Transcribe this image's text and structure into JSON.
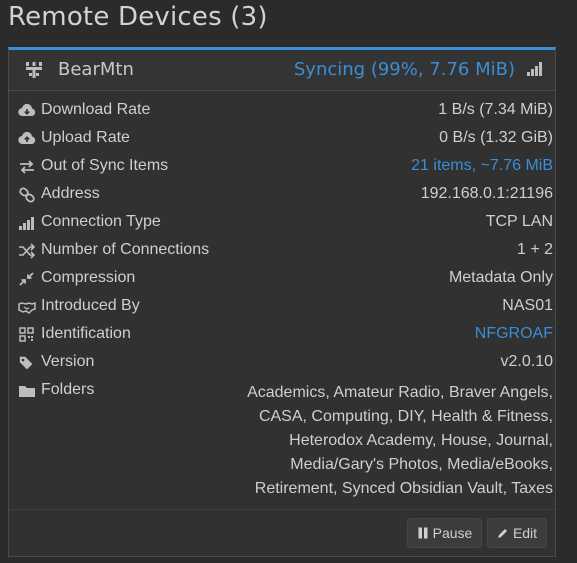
{
  "page": {
    "title": "Remote Devices (3)"
  },
  "device": {
    "name": "BearMtn",
    "status": "Syncing (99%, 7.76 MiB)",
    "rows": [
      {
        "key": "download_rate",
        "label": "Download Rate",
        "value": "1 B/s (7.34 MiB)",
        "icon": "cloud-download-icon"
      },
      {
        "key": "upload_rate",
        "label": "Upload Rate",
        "value": "0 B/s (1.32 GiB)",
        "icon": "cloud-upload-icon"
      },
      {
        "key": "out_of_sync",
        "label": "Out of Sync Items",
        "value": "21 items, ~7.76 MiB",
        "icon": "exchange-icon",
        "link": true
      },
      {
        "key": "address",
        "label": "Address",
        "value": "192.168.0.1:21196",
        "icon": "link-icon"
      },
      {
        "key": "connection_type",
        "label": "Connection Type",
        "value": "TCP LAN",
        "icon": "signal-icon"
      },
      {
        "key": "num_connections",
        "label": "Number of Connections",
        "value": "1 + 2",
        "icon": "random-icon"
      },
      {
        "key": "compression",
        "label": "Compression",
        "value": "Metadata Only",
        "icon": "compress-icon"
      },
      {
        "key": "introduced_by",
        "label": "Introduced By",
        "value": "NAS01",
        "icon": "handshake-icon"
      },
      {
        "key": "identification",
        "label": "Identification",
        "value": "NFGROAF",
        "icon": "qrcode-icon",
        "link": true
      },
      {
        "key": "version",
        "label": "Version",
        "value": "v2.0.10",
        "icon": "tag-icon"
      }
    ],
    "folders": {
      "label": "Folders",
      "icon": "folder-icon",
      "lines": [
        "Academics, Amateur Radio, Braver Angels,",
        "CASA, Computing, DIY, Health & Fitness,",
        "Heterodox Academy, House, Journal,",
        "Media/Gary's Photos, Media/eBooks,",
        "Retirement, Synced Obsidian Vault, Taxes"
      ]
    },
    "buttons": {
      "pause": "Pause",
      "edit": "Edit"
    }
  },
  "colors": {
    "accent": "#3b8ed6",
    "background": "#2b2b2b",
    "panel": "#313131"
  }
}
